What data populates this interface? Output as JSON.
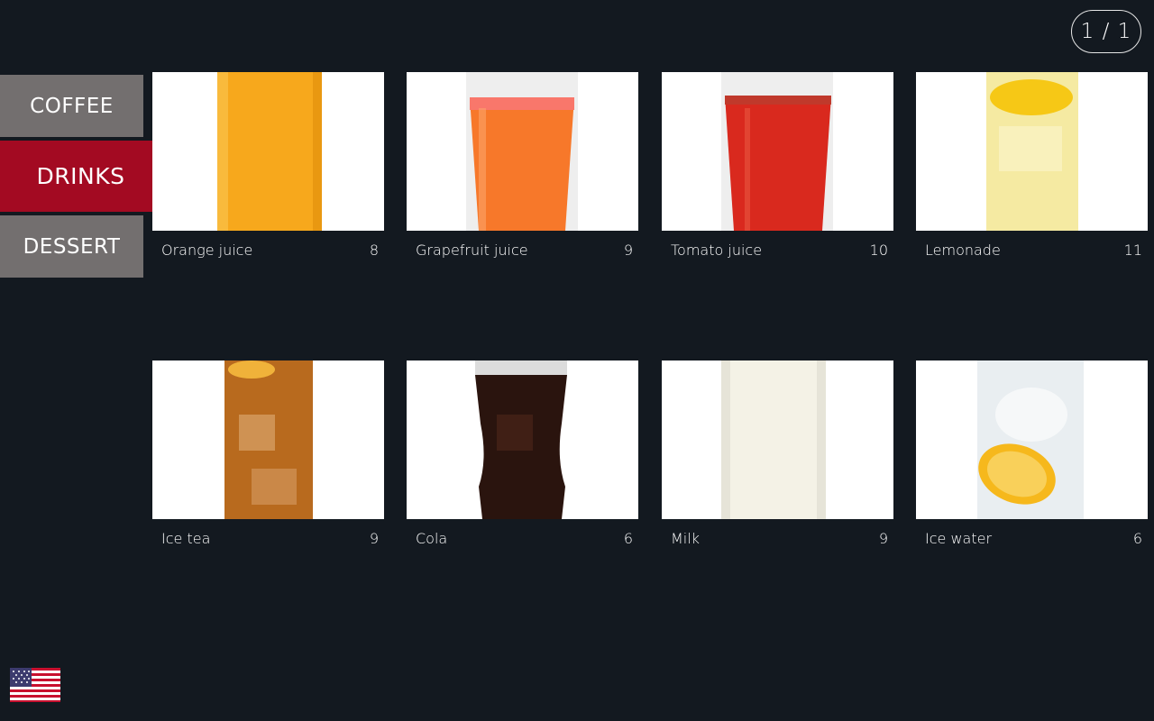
{
  "pager": {
    "label": "1 / 1"
  },
  "categories": [
    {
      "label": "COFFEE",
      "active": false
    },
    {
      "label": "DRINKS",
      "active": true
    },
    {
      "label": "DESSERT",
      "active": false
    }
  ],
  "products": [
    {
      "name": "Orange juice",
      "price": "8",
      "color": "#f7a81c"
    },
    {
      "name": "Grapefruit juice",
      "price": "9",
      "color": "#f7782a"
    },
    {
      "name": "Tomato juice",
      "price": "10",
      "color": "#d9291e"
    },
    {
      "name": "Lemonade",
      "price": "11",
      "color": "#f2e48a"
    },
    {
      "name": "Ice tea",
      "price": "9",
      "color": "#b86a1e"
    },
    {
      "name": "Cola",
      "price": "6",
      "color": "#2a140e"
    },
    {
      "name": "Milk",
      "price": "9",
      "color": "#f4f2e6"
    },
    {
      "name": "Ice water",
      "price": "6",
      "color": "#dfe6ea"
    }
  ],
  "language": {
    "icon": "us-flag-icon"
  }
}
